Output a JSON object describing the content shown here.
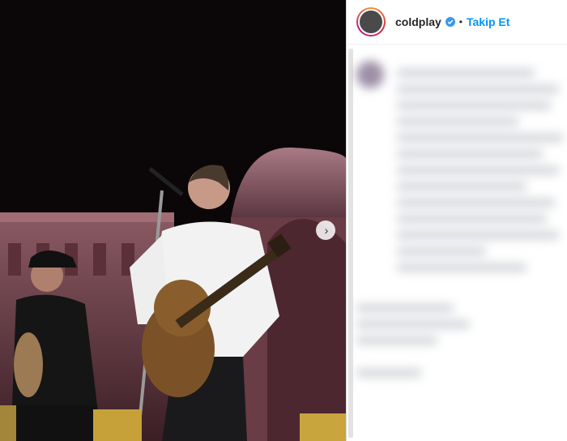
{
  "post": {
    "username": "coldplay",
    "separator": "•",
    "follow_label": "Takip Et"
  },
  "media": {
    "description_icon": "chevron-right-icon"
  },
  "colors": {
    "follow": "#0095f6",
    "text": "#262626",
    "background": "#ffffff",
    "media_bg": "#0a0607",
    "verified": "#3897f0"
  }
}
